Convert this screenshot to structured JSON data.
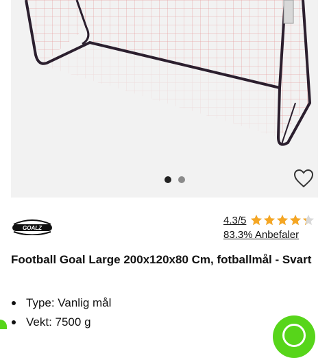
{
  "product": {
    "title": "Football Goal Large 200x120x80 Cm, fotballmål - Svart",
    "brand_logo_text": "GOALZ",
    "rating": {
      "score_text": "4.3/5",
      "stars_value": 4.3,
      "stars_max": 5,
      "recommend_text": "83.3% Anbefaler"
    },
    "features": [
      "Type: Vanlig mål",
      "Vekt: 7500 g"
    ]
  },
  "gallery": {
    "image_count": 2,
    "active_index": 0
  },
  "icons": {
    "favorite": "heart-outline-icon",
    "star": "star-icon",
    "chat": "chat-icon"
  },
  "colors": {
    "star": "#f5a623",
    "accent_green": "#57d51a",
    "image_background": "#f2f2f2"
  }
}
